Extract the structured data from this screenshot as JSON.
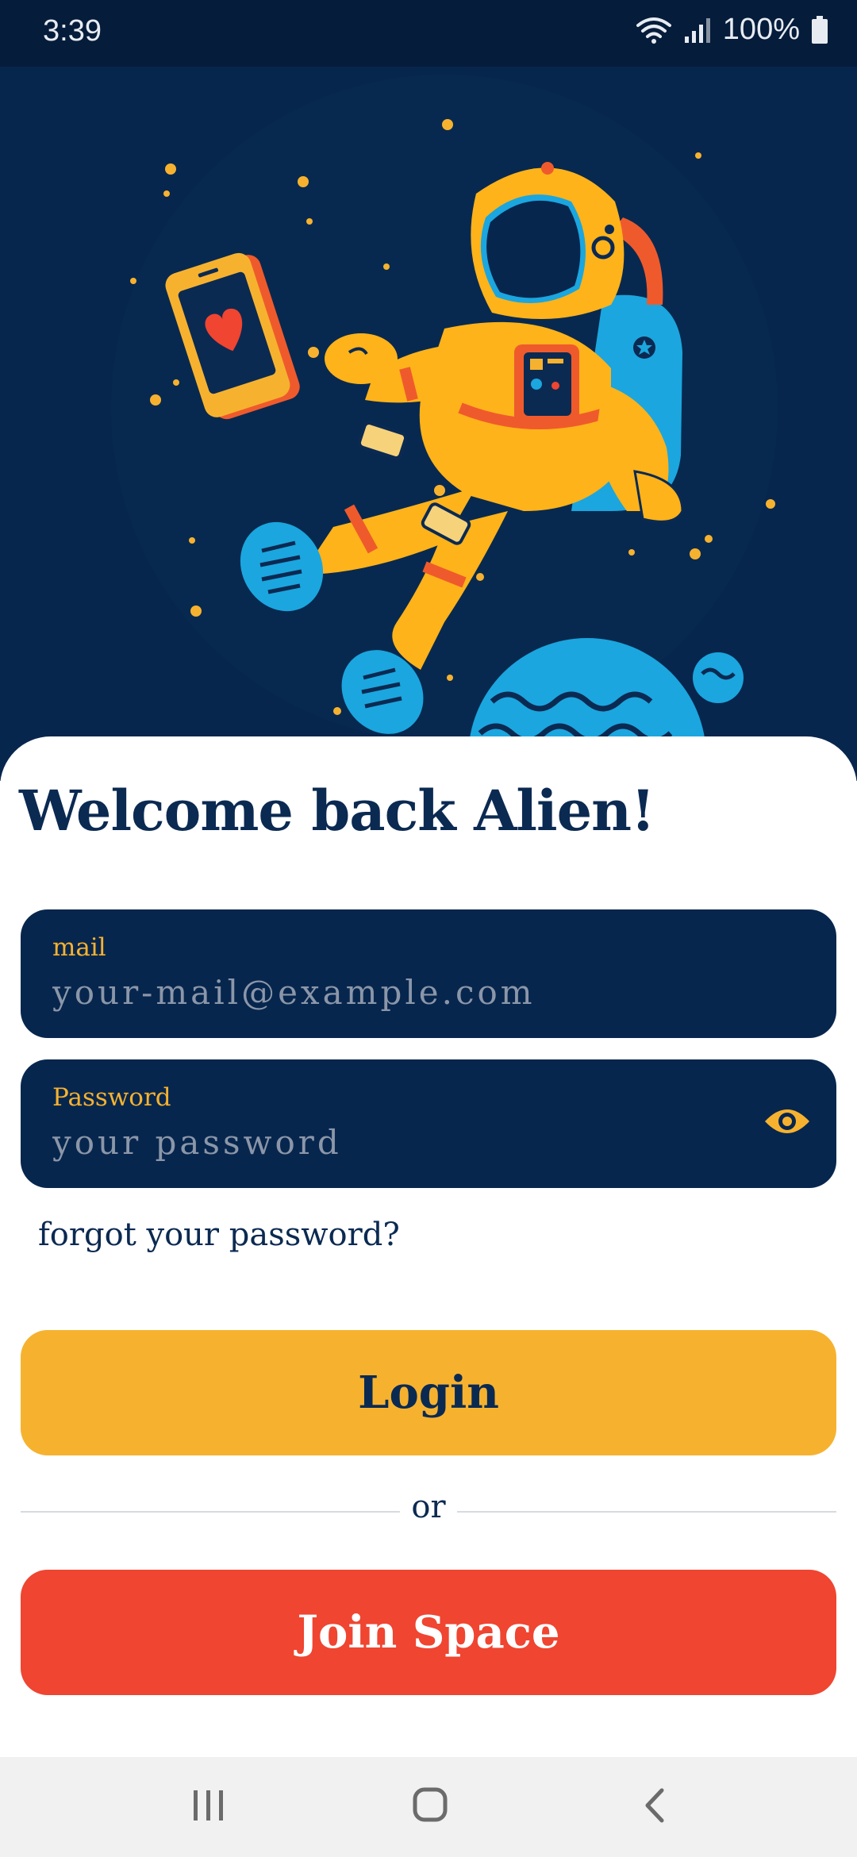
{
  "status_bar": {
    "time": "3:39",
    "battery": "100%",
    "icons": [
      "wifi-icon",
      "signal-icon",
      "battery-icon"
    ]
  },
  "hero": {
    "illustration": "astronaut floating in space holding a phone with a heart",
    "icons": [
      "astronaut-illustration",
      "phone-heart-icon",
      "planet-icon",
      "stars"
    ]
  },
  "login": {
    "title": "Welcome back Alien!",
    "mail_label": "mail",
    "mail_placeholder": "your-mail@example.com",
    "password_label": "Password",
    "password_placeholder": "your password",
    "forgot_link": "forgot your password?",
    "login_button": "Login",
    "or_text": "or",
    "join_button": "Join Space"
  },
  "nav_bar": {
    "icons": [
      "recent-apps-icon",
      "home-icon",
      "back-icon"
    ]
  },
  "colors": {
    "navy": "#07264e",
    "accent_yellow": "#f6b22f",
    "accent_red": "#ef4531",
    "text_dark": "#0b2a52",
    "placeholder": "#8b96a8"
  }
}
